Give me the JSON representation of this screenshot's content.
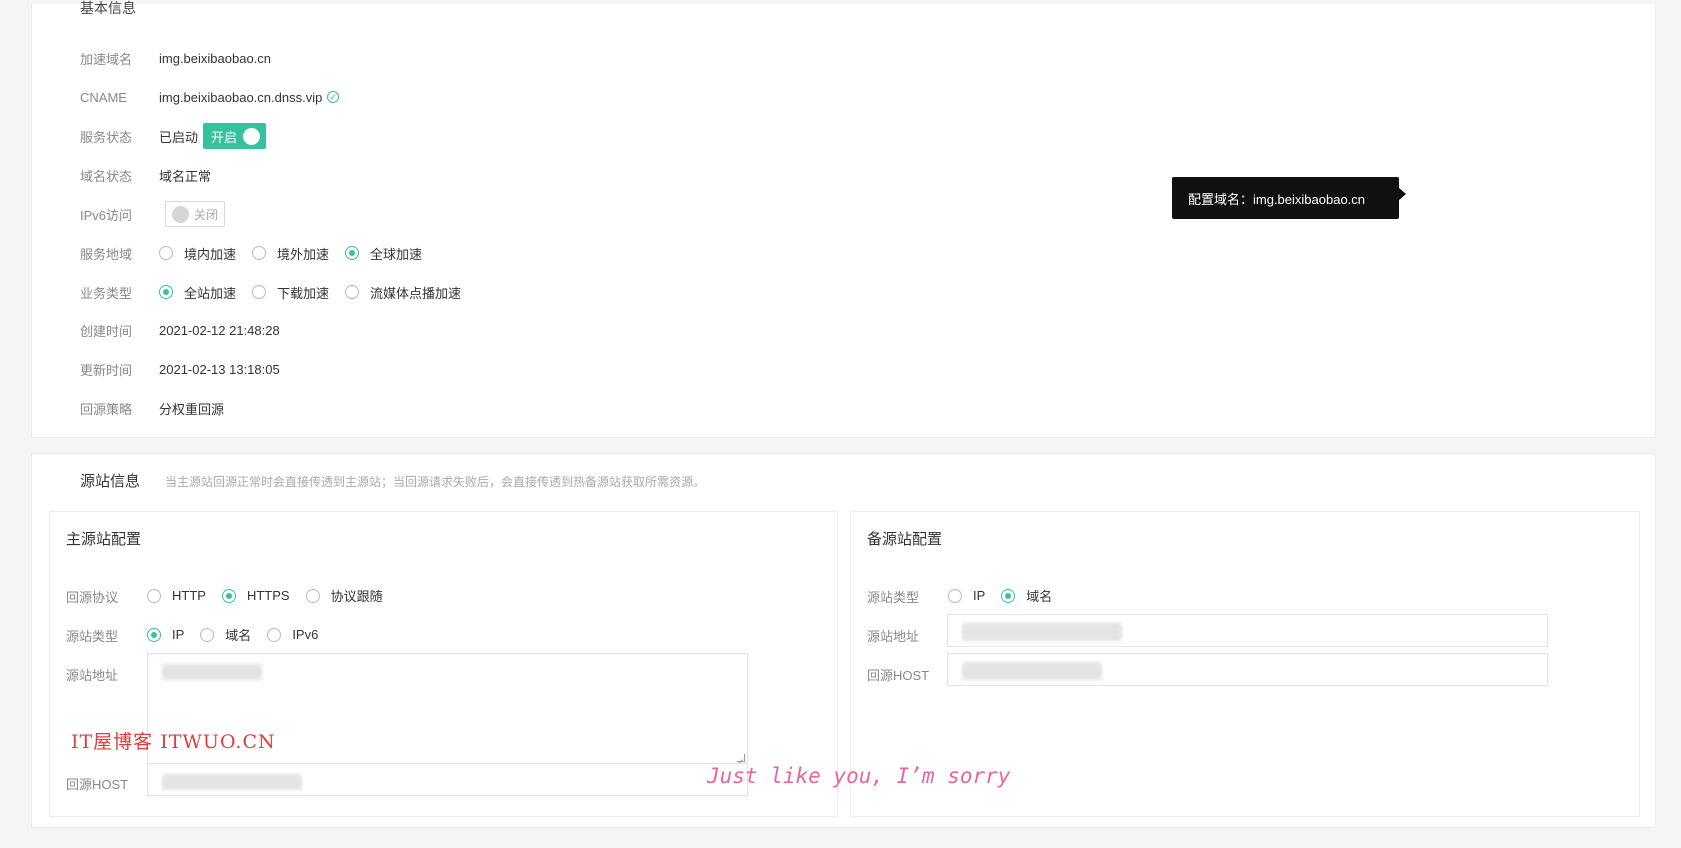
{
  "basic": {
    "section_title": "基本信息",
    "rows": {
      "accel_domain": {
        "label": "加速域名",
        "value": "img.beixibaobao.cn"
      },
      "cname": {
        "label": "CNAME",
        "value": "img.beixibaobao.cn.dnss.vip"
      },
      "service_status": {
        "label": "服务状态",
        "value": "已启动",
        "switch_label": "开启"
      },
      "domain_status": {
        "label": "域名状态",
        "value": "域名正常"
      },
      "ipv6": {
        "label": "IPv6访问",
        "switch_label": "关闭"
      },
      "service_region": {
        "label": "服务地域",
        "options": [
          "境内加速",
          "境外加速",
          "全球加速"
        ],
        "selected": "全球加速"
      },
      "business_type": {
        "label": "业务类型",
        "options": [
          "全站加速",
          "下载加速",
          "流媒体点播加速"
        ],
        "selected": "全站加速"
      },
      "created": {
        "label": "创建时间",
        "value": "2021-02-12 21:48:28"
      },
      "updated": {
        "label": "更新时间",
        "value": "2021-02-13 13:18:05"
      },
      "origin_policy": {
        "label": "回源策略",
        "value": "分权重回源"
      }
    },
    "tooltip": "配置域名：img.beixibaobao.cn"
  },
  "origin": {
    "title": "源站信息",
    "description": "当主源站回源正常时会直接传透到主源站；当回源请求失败后，会直接传透到热备源站获取所需资源。",
    "main": {
      "title": "主源站配置",
      "protocol": {
        "label": "回源协议",
        "options": [
          "HTTP",
          "HTTPS",
          "协议跟随"
        ],
        "selected": "HTTPS"
      },
      "type": {
        "label": "源站类型",
        "options": [
          "IP",
          "域名",
          "IPv6"
        ],
        "selected": "IP"
      },
      "address": {
        "label": "源站地址"
      },
      "host": {
        "label": "回源HOST"
      }
    },
    "backup": {
      "title": "备源站配置",
      "type": {
        "label": "源站类型",
        "options": [
          "IP",
          "域名"
        ],
        "selected": "域名"
      },
      "address": {
        "label": "源站地址"
      },
      "host": {
        "label": "回源HOST"
      }
    }
  },
  "watermarks": {
    "blog": "IT屋博客 ITWUO.CN",
    "handwritten": "Just like you, I’m sorry"
  },
  "colors": {
    "accent": "#36c29f",
    "tooltip_bg": "#111111"
  }
}
